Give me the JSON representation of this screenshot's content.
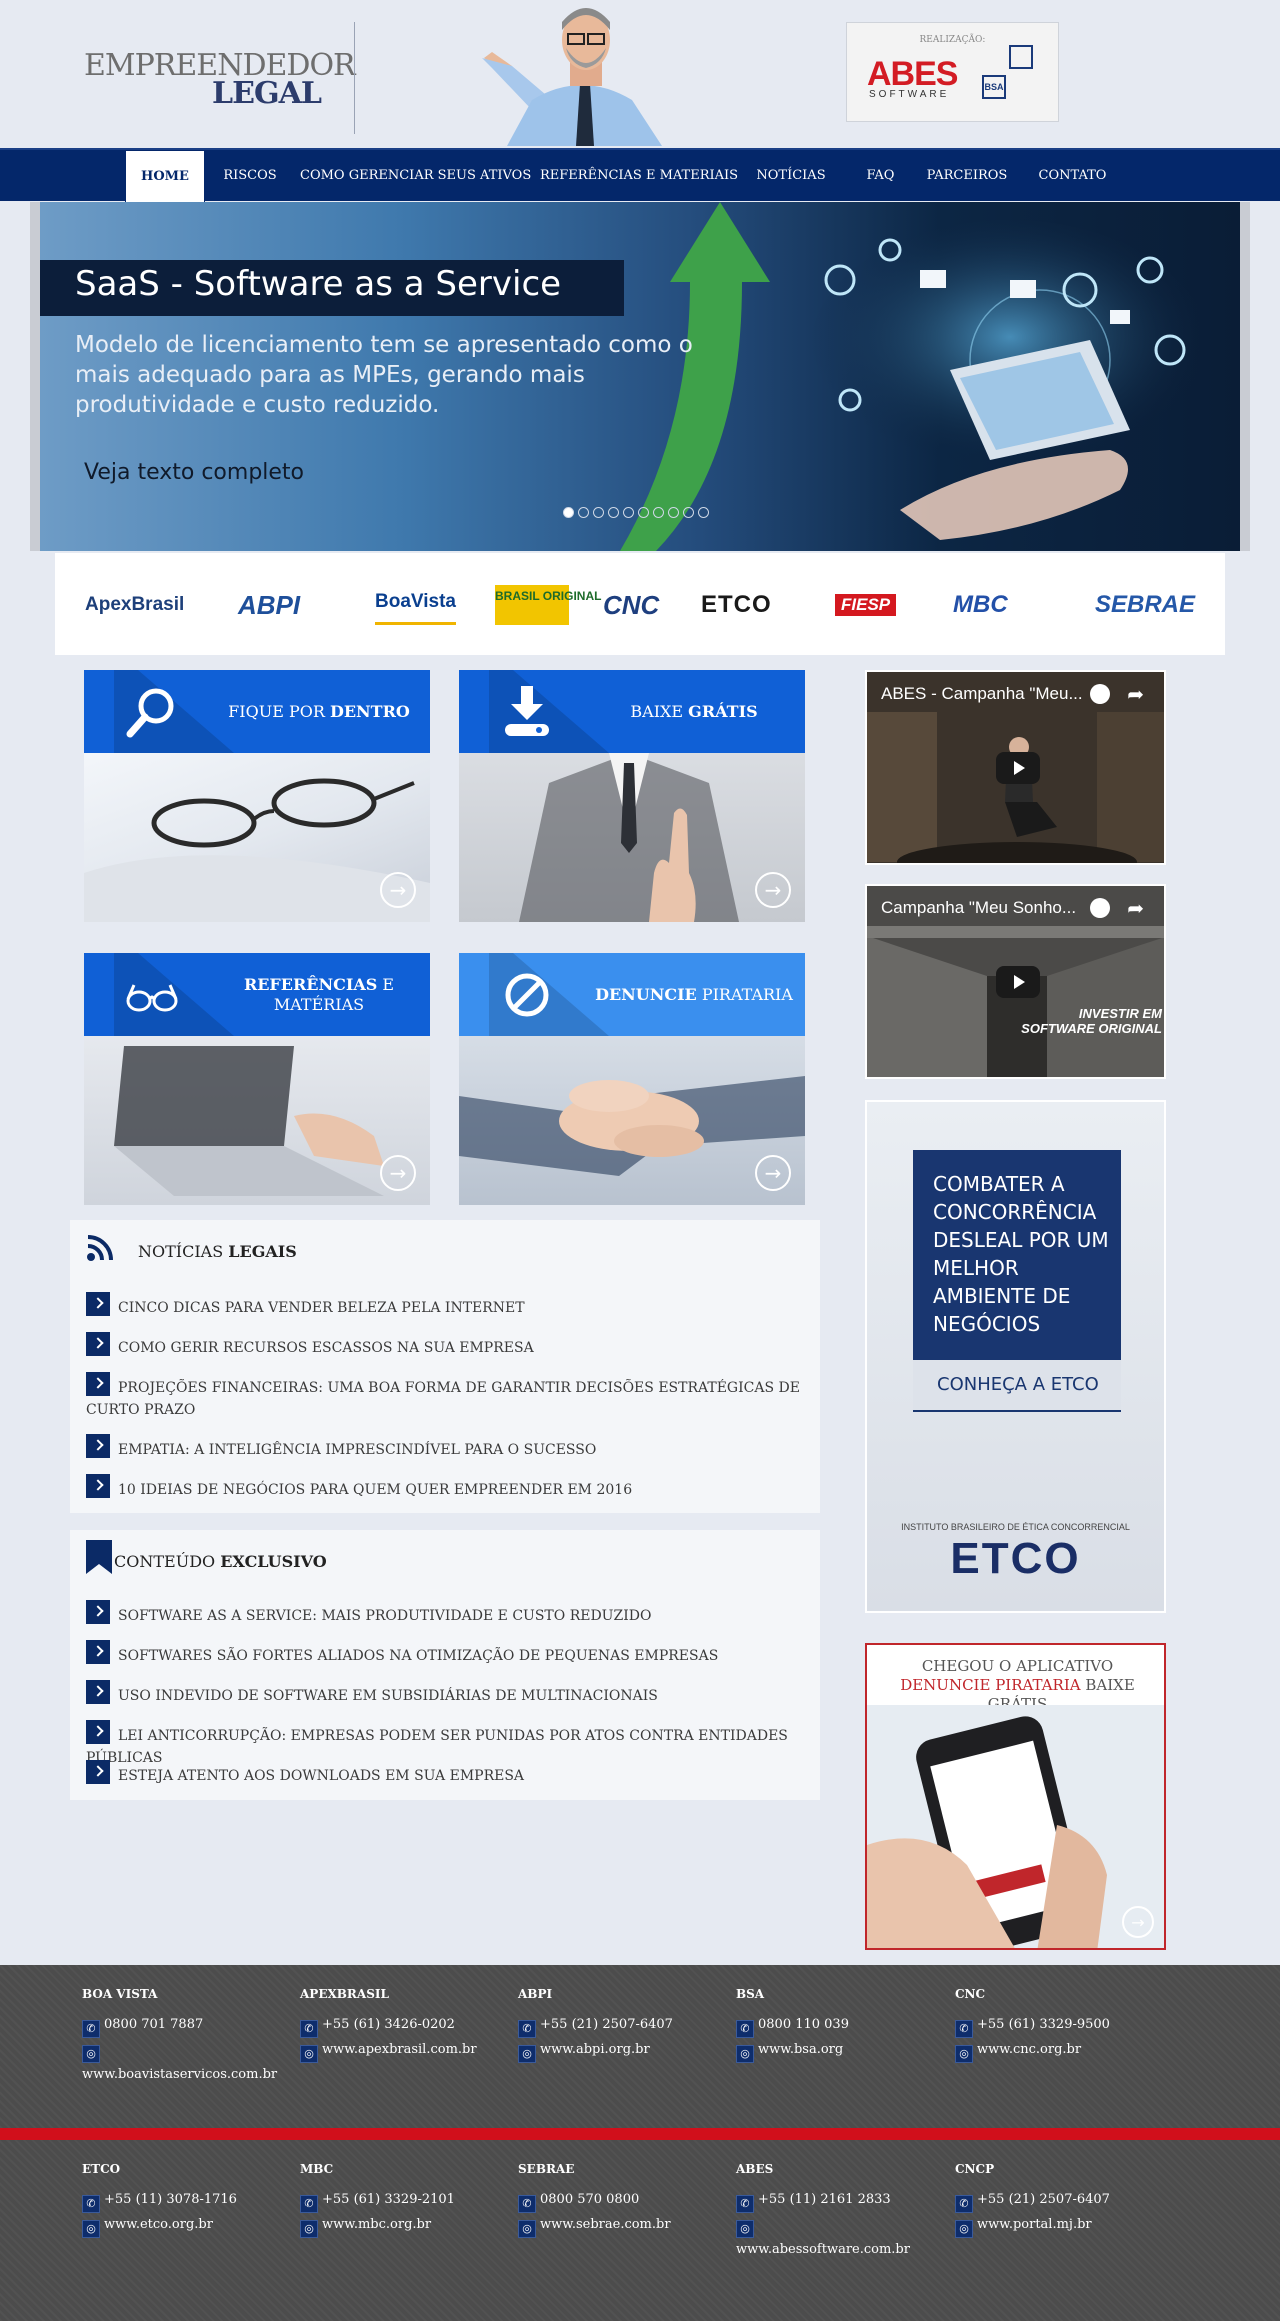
{
  "header": {
    "logo_line1": "EMPREENDEDOR",
    "logo_line2": "LEGAL",
    "sponsor_label": "REALIZAÇÃO:",
    "sponsor_name": "ABES",
    "sponsor_sub": "SOFTWARE",
    "sponsor_badge": "BSA"
  },
  "nav": {
    "items": [
      {
        "label": "HOME",
        "active": true
      },
      {
        "label": "RISCOS"
      },
      {
        "label": "COMO GERENCIAR SEUS ATIVOS"
      },
      {
        "label": "REFERÊNCIAS E MATERIAIS"
      },
      {
        "label": "NOTÍCIAS"
      },
      {
        "label": "FAQ"
      },
      {
        "label": "PARCEIROS"
      },
      {
        "label": "CONTATO"
      }
    ]
  },
  "slider": {
    "title": "SaaS - Software as a Service",
    "text": "Modelo de licenciamento tem se apresentado como o mais adequado para as MPEs, gerando mais produtividade e custo reduzido.",
    "link": "Veja texto completo",
    "dot_count": 10,
    "active_dot": 1
  },
  "partners": [
    "ApexBrasil",
    "ABPI",
    "BoaVista",
    "BRASIL ORIGINAL",
    "CNC",
    "ETCO",
    "FIESP",
    "MBC",
    "SEBRAE"
  ],
  "tiles": [
    {
      "pre": "FIQUE POR ",
      "bold": "DENTRO",
      "post": ""
    },
    {
      "pre": "BAIXE ",
      "bold": "GRÁTIS",
      "post": ""
    },
    {
      "pre": "",
      "bold": "REFERÊNCIAS",
      "post": " E MATÉRIAS"
    },
    {
      "pre": "",
      "bold": "DENUNCIE",
      "post": " PIRATARIA"
    }
  ],
  "videos": [
    {
      "title": "ABES - Campanha \"Meu..."
    },
    {
      "title": "Campanha \"Meu Sonho...",
      "overlay": "INVESTIR EM SOFTWARE ORIGINAL"
    }
  ],
  "etco_ad": {
    "text": "COMBATER A CONCORRÊNCIA DESLEAL POR UM MELHOR AMBIENTE DE NEGÓCIOS",
    "cta": "CONHEÇA A ETCO",
    "sub": "INSTITUTO BRASILEIRO DE ÉTICA CONCORRENCIAL",
    "logo": "ETCO"
  },
  "app_ad": {
    "line1": "CHEGOU O APLICATIVO ",
    "red": "DENUNCIE PIRATARIA",
    "line2": " BAIXE GRÁTIS"
  },
  "news": {
    "title_pre": "NOTÍCIAS ",
    "title_bold": "LEGAIS",
    "items": [
      "CINCO DICAS PARA VENDER BELEZA PELA INTERNET",
      "COMO GERIR RECURSOS ESCASSOS NA SUA EMPRESA",
      "PROJEÇÕES FINANCEIRAS: UMA BOA FORMA DE GARANTIR DECISÕES ESTRATÉGICAS DE CURTO PRAZO",
      "EMPATIA: A INTELIGÊNCIA IMPRESCINDÍVEL PARA O SUCESSO",
      "10 IDEIAS DE NEGÓCIOS PARA QUEM QUER EMPREENDER EM 2016"
    ]
  },
  "exclusive": {
    "title_pre": "CONTEÚDO ",
    "title_bold": "EXCLUSIVO",
    "items": [
      "SOFTWARE AS A SERVICE: MAIS PRODUTIVIDADE E CUSTO REDUZIDO",
      "SOFTWARES SÃO FORTES ALIADOS NA OTIMIZAÇÃO DE PEQUENAS EMPRESAS",
      "USO INDEVIDO DE SOFTWARE EM SUBSIDIÁRIAS DE MULTINACIONAIS",
      "LEI ANTICORRUPÇÃO: EMPRESAS PODEM SER PUNIDAS POR ATOS CONTRA ENTIDADES PÚBLICAS",
      "ESTEJA ATENTO AOS DOWNLOADS EM SUA EMPRESA"
    ]
  },
  "footer": {
    "row1": [
      {
        "name": "BOA VISTA",
        "phone": "0800 701 7887",
        "site": "www.boavistaservicos.com.br",
        "wrap": true
      },
      {
        "name": "APEXBRASIL",
        "phone": "+55 (61) 3426-0202",
        "site": "www.apexbrasil.com.br"
      },
      {
        "name": "ABPI",
        "phone": "+55 (21) 2507-6407",
        "site": "www.abpi.org.br"
      },
      {
        "name": "BSA",
        "phone": "0800 110 039",
        "site": "www.bsa.org"
      },
      {
        "name": "CNC",
        "phone": "+55 (61) 3329-9500",
        "site": "www.cnc.org.br"
      }
    ],
    "row2": [
      {
        "name": "ETCO",
        "phone": "+55 (11) 3078-1716",
        "site": "www.etco.org.br"
      },
      {
        "name": "MBC",
        "phone": "+55 (61) 3329-2101",
        "site": "www.mbc.org.br"
      },
      {
        "name": "SEBRAE",
        "phone": "0800 570 0800",
        "site": "www.sebrae.com.br"
      },
      {
        "name": "ABES",
        "phone": "+55 (11) 2161 2833",
        "site": "www.abessoftware.com.br",
        "wrap": true
      },
      {
        "name": "CNCP",
        "phone": "+55 (21) 2507-6407",
        "site": "www.portal.mj.br"
      }
    ]
  },
  "colors": {
    "nav": "#04276a",
    "tile_blue": "#1060d6",
    "tile_light": "#3a8fee",
    "accent_red": "#d10f1b"
  }
}
